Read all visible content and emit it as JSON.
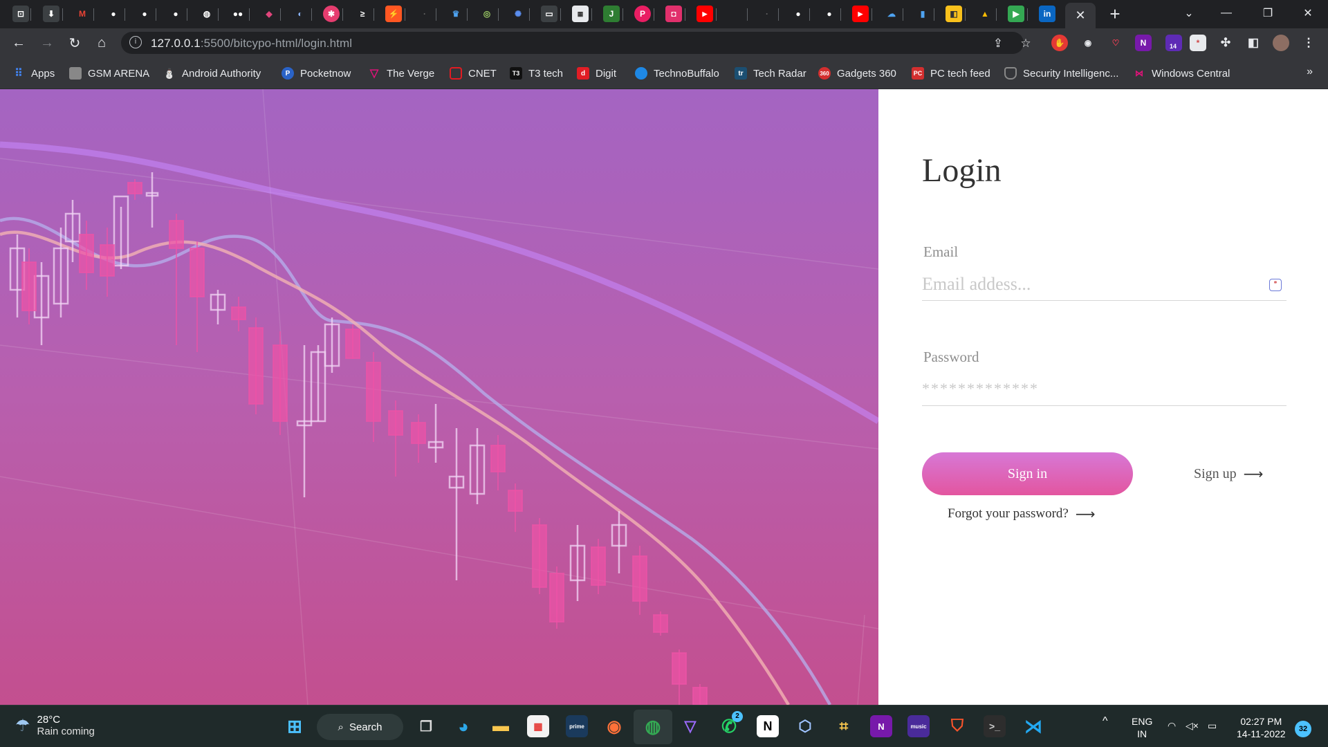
{
  "browser": {
    "url_host": "127.0.0.1",
    "url_rest": ":5500/bitcypo-html/login.html",
    "active_tab_close": "✕",
    "new_tab": "+"
  },
  "bookmarks": [
    {
      "label": "Apps",
      "icon": "apps-grid-icon",
      "color": "#4285f4"
    },
    {
      "label": "GSM ARENA",
      "icon": "gsmarena-icon",
      "color": "#888888"
    },
    {
      "label": "Android Authority",
      "icon": "android-authority-icon",
      "color": "#3ddc84"
    },
    {
      "label": "Pocketnow",
      "icon": "pocketnow-icon",
      "color": "#2a63c8"
    },
    {
      "label": "The Verge",
      "icon": "verge-icon",
      "color": "#e2127a"
    },
    {
      "label": "CNET",
      "icon": "cnet-icon",
      "color": "#e21b22"
    },
    {
      "label": "T3 tech",
      "icon": "t3-icon",
      "color": "#222222"
    },
    {
      "label": "Digit",
      "icon": "digit-icon",
      "color": "#e11d25"
    },
    {
      "label": "TechnoBuffalo",
      "icon": "technobuffalo-icon",
      "color": "#1e88e5"
    },
    {
      "label": "Tech Radar",
      "icon": "techradar-icon",
      "color": "#1b4f72"
    },
    {
      "label": "Gadgets 360",
      "icon": "gadgets360-icon",
      "color": "#d32f2f"
    },
    {
      "label": "PC tech feed",
      "icon": "pcmag-icon",
      "color": "#d32f2f"
    },
    {
      "label": "Security Intelligenc...",
      "icon": "shield-icon",
      "color": "#444444"
    },
    {
      "label": "Windows Central",
      "icon": "windows-central-icon",
      "color": "#8e24aa"
    }
  ],
  "login": {
    "title": "Login",
    "email_label": "Email",
    "email_placeholder": "Email addess...",
    "password_label": "Password",
    "password_placeholder": "*************",
    "signin_label": "Sign in",
    "signup_label": "Sign up",
    "forgot_label": "Forgot your password?",
    "arrow": "⟶"
  },
  "taskbar": {
    "temp": "28°C",
    "weather": "Rain coming",
    "search_label": "Search",
    "lang_top": "ENG",
    "lang_bottom": "IN",
    "time": "02:27 PM",
    "date": "14-11-2022",
    "notif_count": "32",
    "whatsapp_badge": "2",
    "ext_badge": "14"
  }
}
